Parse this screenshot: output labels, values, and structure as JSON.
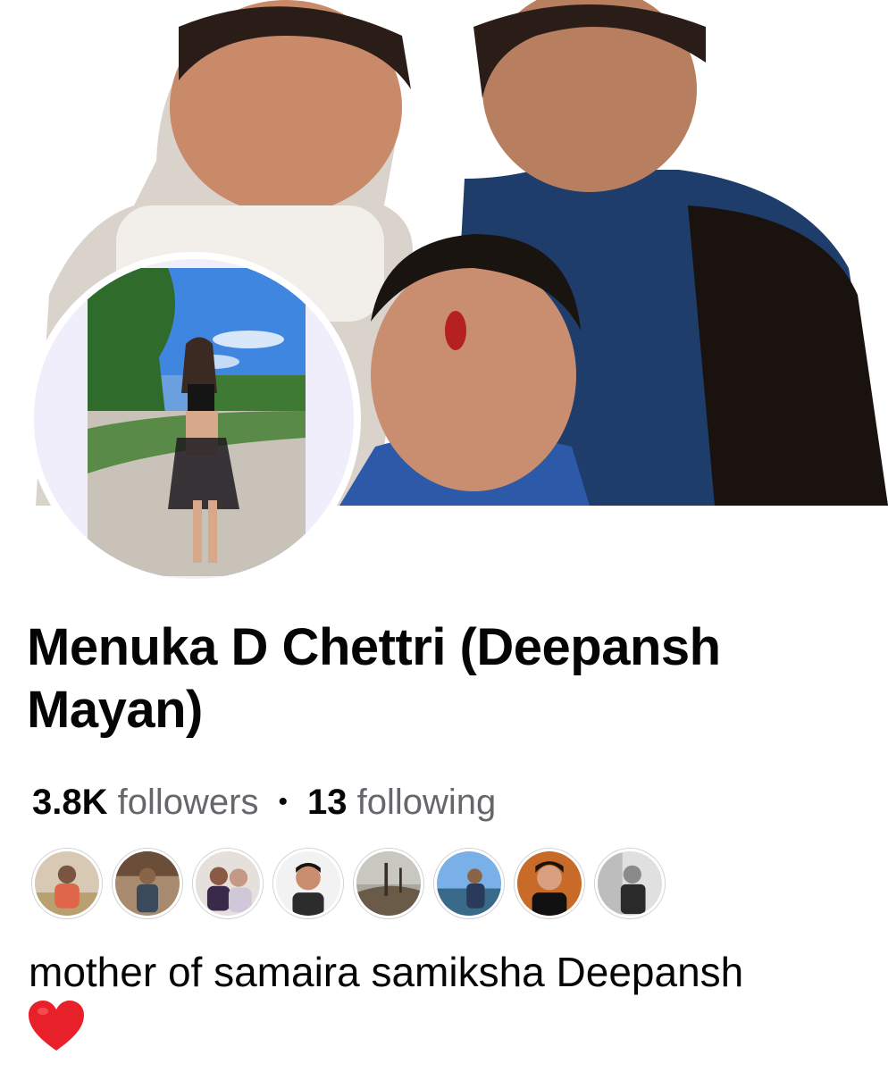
{
  "profile": {
    "name": "Menuka D Chettri (Deepansh Mayan)",
    "followers_count": "3.8K",
    "followers_label": "followers",
    "separator": "•",
    "following_count": "13",
    "following_label": "following",
    "bio": "mother of samaira samiksha Deepansh",
    "bio_emoji": "red-heart-icon"
  },
  "friends": [
    {
      "name": "friend-1"
    },
    {
      "name": "friend-2"
    },
    {
      "name": "friend-3"
    },
    {
      "name": "friend-4"
    },
    {
      "name": "friend-5"
    },
    {
      "name": "friend-6"
    },
    {
      "name": "friend-7"
    },
    {
      "name": "friend-8"
    }
  ],
  "colors": {
    "text_primary": "#050505",
    "text_secondary": "#65676b",
    "heart": "#e8202a"
  }
}
